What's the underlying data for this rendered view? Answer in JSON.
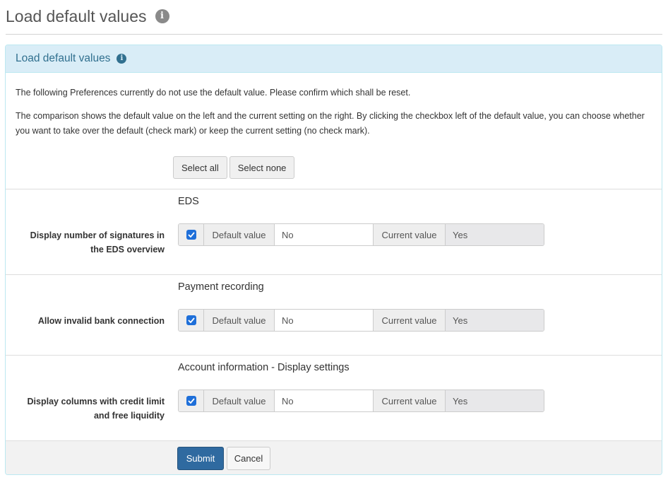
{
  "page": {
    "title": "Load default values"
  },
  "panel": {
    "title": "Load default values",
    "intro_1": "The following Preferences currently do not use the default value. Please confirm which shall be reset.",
    "intro_2": "The comparison shows the default value on the left and the current setting on the right. By clicking the checkbox left of the default value, you can choose whether you want to take over the default (check mark) or keep the current setting (no check mark).",
    "select_all": "Select all",
    "select_none": "Select none"
  },
  "compare_labels": {
    "default": "Default value",
    "current": "Current value"
  },
  "sections": [
    {
      "title": "EDS",
      "label_line1": "Display number of signatures in",
      "label_line2": "the EDS overview",
      "checked": true,
      "default_value": "No",
      "current_value": "Yes"
    },
    {
      "title": "Payment recording",
      "label_line1": "Allow invalid bank connection",
      "label_line2": "",
      "checked": true,
      "default_value": "No",
      "current_value": "Yes"
    },
    {
      "title": "Account information - Display settings",
      "label_line1": "Display columns with credit limit",
      "label_line2": "and free liquidity",
      "checked": true,
      "default_value": "No",
      "current_value": "Yes"
    }
  ],
  "footer": {
    "submit": "Submit",
    "cancel": "Cancel"
  },
  "colors": {
    "heading_bg": "#d9edf7",
    "heading_text": "#31708f",
    "checkbox": "#1e6fd9",
    "submit_bg": "#2f6aa0"
  },
  "icons": {
    "title_info": "info-circle-icon",
    "panel_info": "info-circle-icon",
    "checkbox": "check-icon"
  }
}
